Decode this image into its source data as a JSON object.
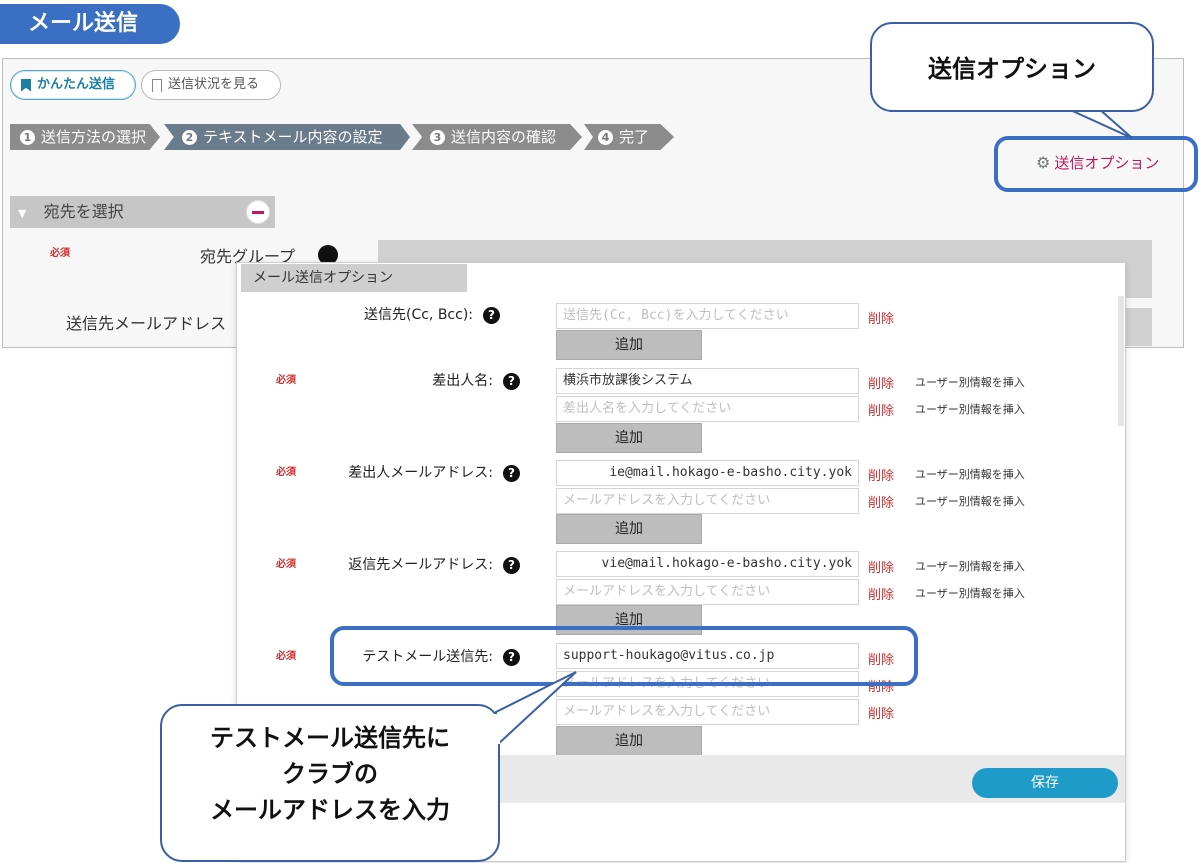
{
  "page_title": "メール送信",
  "tabs": [
    {
      "label": "かんたん送信",
      "active": true
    },
    {
      "label": "送信状況を見る",
      "active": false
    }
  ],
  "steps": [
    {
      "num": "1",
      "label": "送信方法の選択"
    },
    {
      "num": "2",
      "label": "テキストメール内容の設定"
    },
    {
      "num": "3",
      "label": "送信内容の確認"
    },
    {
      "num": "4",
      "label": "完了"
    }
  ],
  "options_link": "送信オプション",
  "section": {
    "title": "宛先を選択",
    "required": "必須",
    "group_label": "宛先グループ",
    "address_label": "送信先メールアドレス"
  },
  "modal": {
    "title": "メール送信オプション",
    "required": "必須",
    "help_glyph": "?",
    "delete_label": "削除",
    "add_label": "追加",
    "user_insert_label": "ユーザー別情報を挿入",
    "rows": {
      "cc": {
        "label": "送信先(Cc, Bcc):",
        "placeholder": "送信先(Cc, Bcc)を入力してください"
      },
      "sender_name": {
        "label": "差出人名:",
        "value": "横浜市放課後システム",
        "placeholder": "差出人名を入力してください"
      },
      "sender_addr": {
        "label": "差出人メールアドレス:",
        "value": "ie@mail.hokago-e-basho.city.yok",
        "placeholder": "メールアドレスを入力してください"
      },
      "reply_addr": {
        "label": "返信先メールアドレス:",
        "value": "vie@mail.hokago-e-basho.city.yok",
        "placeholder": "メールアドレスを入力してください"
      },
      "test_addr": {
        "label": "テストメール送信先:",
        "value": "support-houkago@vitus.co.jp",
        "placeholder": "メールアドレスを入力してください"
      }
    },
    "save_label": "保存"
  },
  "callouts": {
    "top": "送信オプション",
    "bottom": [
      "テストメール送信先に",
      "クラブの",
      "メールアドレスを入力"
    ]
  },
  "colors": {
    "accent_blue": "#3a6fc4",
    "save_button": "#1f9bc9",
    "delete_red": "#d32f2f",
    "options_link": "#c2185b"
  }
}
